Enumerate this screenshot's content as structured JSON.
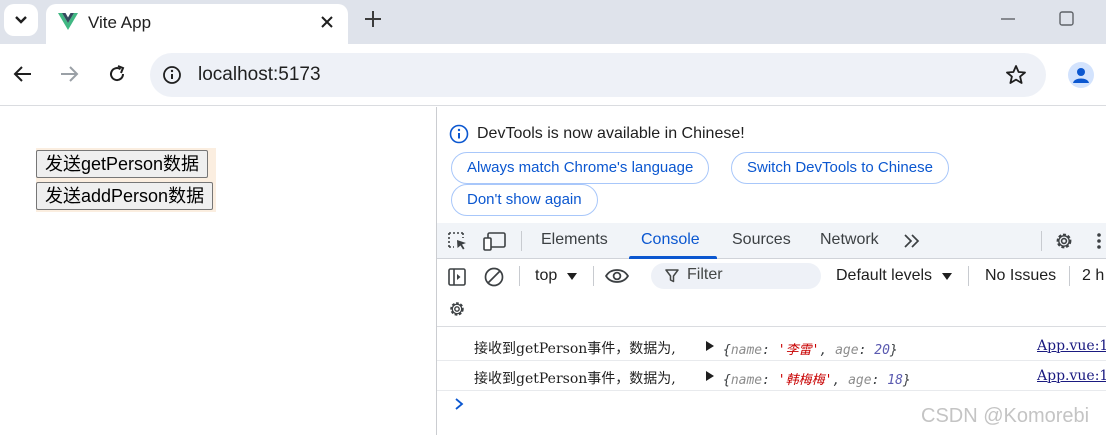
{
  "browser": {
    "tab_title": "Vite App",
    "url": "localhost:5173",
    "favicon": "vue-logo-icon",
    "accent": "#0b57d0"
  },
  "page": {
    "buttons": [
      {
        "label": "发送getPerson数据"
      },
      {
        "label": "发送addPerson数据"
      }
    ]
  },
  "devtools": {
    "infobar": {
      "message": "DevTools is now available in Chinese!",
      "actions": [
        "Always match Chrome's language",
        "Switch DevTools to Chinese",
        "Don't show again"
      ]
    },
    "tabs": [
      "Elements",
      "Console",
      "Sources",
      "Network"
    ],
    "active_tab": "Console",
    "console_toolbar": {
      "context": "top",
      "filter_placeholder": "Filter",
      "levels": "Default levels",
      "issues": "No Issues",
      "hidden_count": "2 h"
    },
    "logs": [
      {
        "text": "接收到getPerson事件，数据为,",
        "obj_open": "{",
        "key1": "name",
        "val1": "'李雷'",
        "key2": "age",
        "val2": "20",
        "obj_close": "}",
        "source": "App.vue:1"
      },
      {
        "text": "接收到getPerson事件，数据为,",
        "obj_open": "{",
        "key1": "name",
        "val1": "'韩梅梅'",
        "key2": "age",
        "val2": "18",
        "obj_close": "}",
        "source": "App.vue:1"
      }
    ]
  },
  "watermark": "CSDN @Komorebi"
}
